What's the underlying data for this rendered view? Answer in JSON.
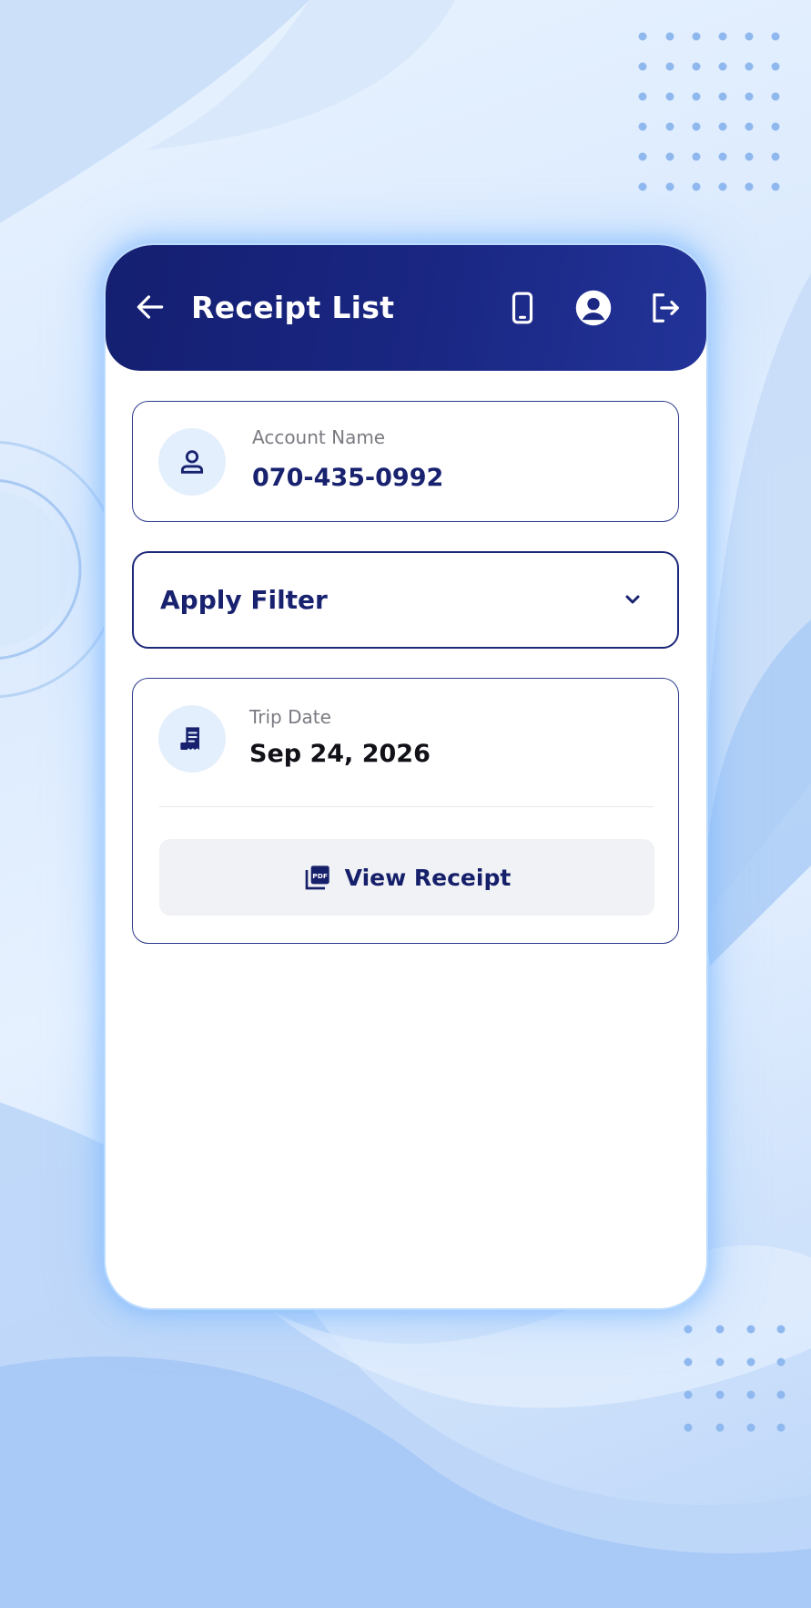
{
  "colors": {
    "header_bg": "#1a2783",
    "primary_text": "#18226f",
    "muted_text": "#7a7a82",
    "card_border": "#2e3a8c",
    "icon_circle_bg": "#e3effc",
    "button_bg": "#f1f2f5"
  },
  "header": {
    "title": "Receipt List",
    "back_icon": "arrow-left-icon",
    "icons": [
      "mobile-phone-icon",
      "user-profile-icon",
      "logout-icon"
    ]
  },
  "account": {
    "label": "Account Name",
    "value": "070-435-0992",
    "icon": "person-icon"
  },
  "filter": {
    "label": "Apply Filter",
    "icon": "chevron-down-icon"
  },
  "trip": {
    "label": "Trip Date",
    "value": "Sep 24, 2026",
    "icon": "receipt-icon",
    "button_label": "View Receipt",
    "button_icon": "pdf-icon"
  }
}
